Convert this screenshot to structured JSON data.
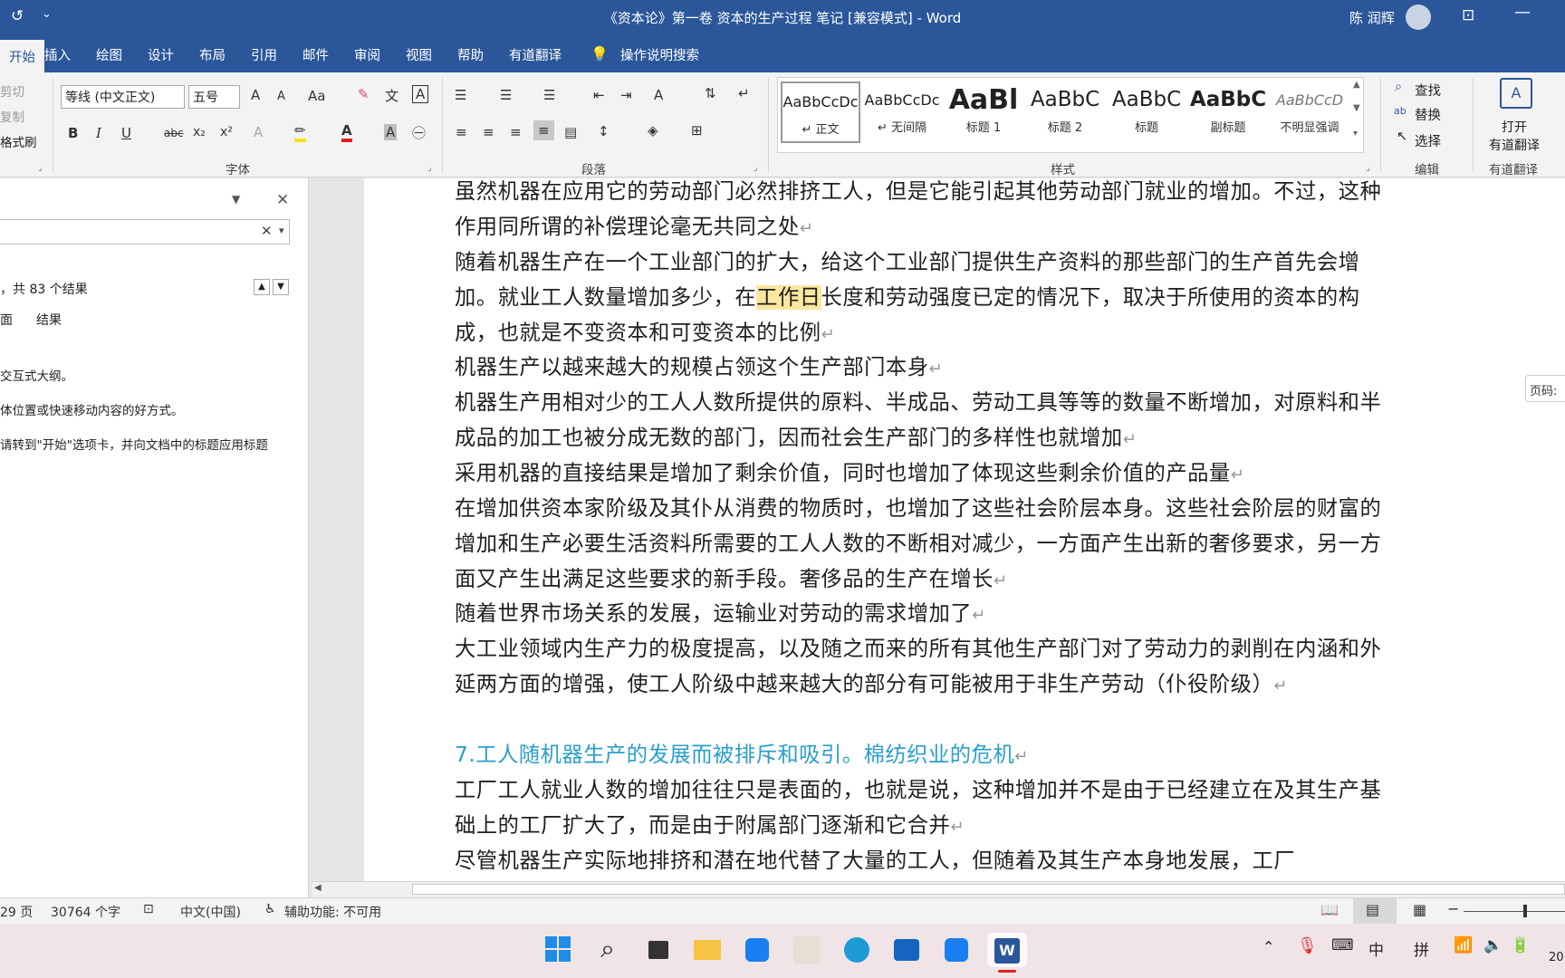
{
  "titlebar": {
    "title": "《资本论》第一卷 资本的生产过程 笔记 [兼容模式] - Word",
    "user": "陈 润辉",
    "customize_glyph": "⌄"
  },
  "ribbon_tabs": [
    "开始",
    "插入",
    "绘图",
    "设计",
    "布局",
    "引用",
    "邮件",
    "审阅",
    "视图",
    "帮助",
    "有道翻译"
  ],
  "tell_me": "操作说明搜索",
  "clipboard": {
    "cut": "剪切",
    "copy": "复制",
    "format_painter": "格式刷"
  },
  "font": {
    "name": "等线 (中文正文)",
    "size": "五号",
    "grow": "A",
    "shrink": "A",
    "change_case": "Aa",
    "bold": "B",
    "italic": "I",
    "underline": "U",
    "strike": "abc",
    "sub": "x₂",
    "sup": "x²",
    "group_label": "字体"
  },
  "paragraph": {
    "group_label": "段落"
  },
  "styles": {
    "items": [
      {
        "preview": "AaBbCcDc",
        "name": "↵ 正文"
      },
      {
        "preview": "AaBbCcDc",
        "name": "↵ 无间隔"
      },
      {
        "preview": "AaBl",
        "name": "标题 1"
      },
      {
        "preview": "AaBbC",
        "name": "标题 2"
      },
      {
        "preview": "AaBbC",
        "name": "标题"
      },
      {
        "preview": "AaBbC",
        "name": "副标题"
      },
      {
        "preview": "AaBbCcD",
        "name": "不明显强调"
      }
    ],
    "group_label": "样式"
  },
  "editing": {
    "find": "查找",
    "replace": "替换",
    "select": "选择",
    "group_label": "编辑"
  },
  "youdao": {
    "open": "打开",
    "open2": "有道翻译",
    "group_label": "有道翻译"
  },
  "navpane": {
    "results": "，共 83 个结果",
    "tab_pages": "面",
    "tab_results": "结果",
    "tip1": "交互式大纲。",
    "tip2": "体位置或快速移动内容的好方式。",
    "tip3": "请转到\"开始\"选项卡，并向文档中的标题应用标题"
  },
  "page_tag": "页码:",
  "document": {
    "paragraphs": [
      {
        "text": "虽然机器在应用它的劳动部门必然排挤工人，但是它能引起其他劳动部门就业的增加。不过，这种作用同所谓的补偿理论毫无共同之处"
      },
      {
        "pre": "随着机器生产在一个工业部门的扩大，给这个工业部门提供生产资料的那些部门的生产首先会增加。就业工人数量增加多少，在",
        "highlight": "工作日",
        "post": "长度和劳动强度已定的情况下，取决于所使用的资本的构成，也就是不变资本和可变资本的比例"
      },
      {
        "text": "机器生产以越来越大的规模占领这个生产部门本身"
      },
      {
        "text": "机器生产用相对少的工人人数所提供的原料、半成品、劳动工具等等的数量不断增加，对原料和半成品的加工也被分成无数的部门，因而社会生产部门的多样性也就增加"
      },
      {
        "text": "采用机器的直接结果是增加了剩余价值，同时也增加了体现这些剩余价值的产品量"
      },
      {
        "text": "在增加供资本家阶级及其仆从消费的物质时，也增加了这些社会阶层本身。这些社会阶层的财富的增加和生产必要生活资料所需要的工人人数的不断相对减少，一方面产生出新的奢侈要求，另一方面又产生出满足这些要求的新手段。奢侈品的生产在增长"
      },
      {
        "text": "随着世界市场关系的发展，运输业对劳动的需求增加了"
      },
      {
        "text": "大工业领域内生产力的极度提高，以及随之而来的所有其他生产部门对了劳动力的剥削在内涵和外延两方面的增强，使工人阶级中越来越大的部分有可能被用于非生产劳动（仆役阶级）"
      },
      {
        "heading": "7.工人随机器生产的发展而被排斥和吸引。棉纺织业的危机"
      },
      {
        "text": "工厂工人就业人数的增加往往只是表面的，也就是说，这种增加并不是由于已经建立在及其生产基础上的工厂扩大了，而是由于附属部门逐渐和它合并"
      },
      {
        "text": "尽管机器生产实际地排挤和潜在地代替了大量的工人，但随着及其生产本身地发展，工厂"
      }
    ]
  },
  "status": {
    "pages": "29 页",
    "words": "30764 个字",
    "language": "中文(中国)",
    "accessibility": "辅助功能: 不可用"
  },
  "taskbar": {
    "ime1": "中",
    "ime2": "拼",
    "clock": "20"
  }
}
